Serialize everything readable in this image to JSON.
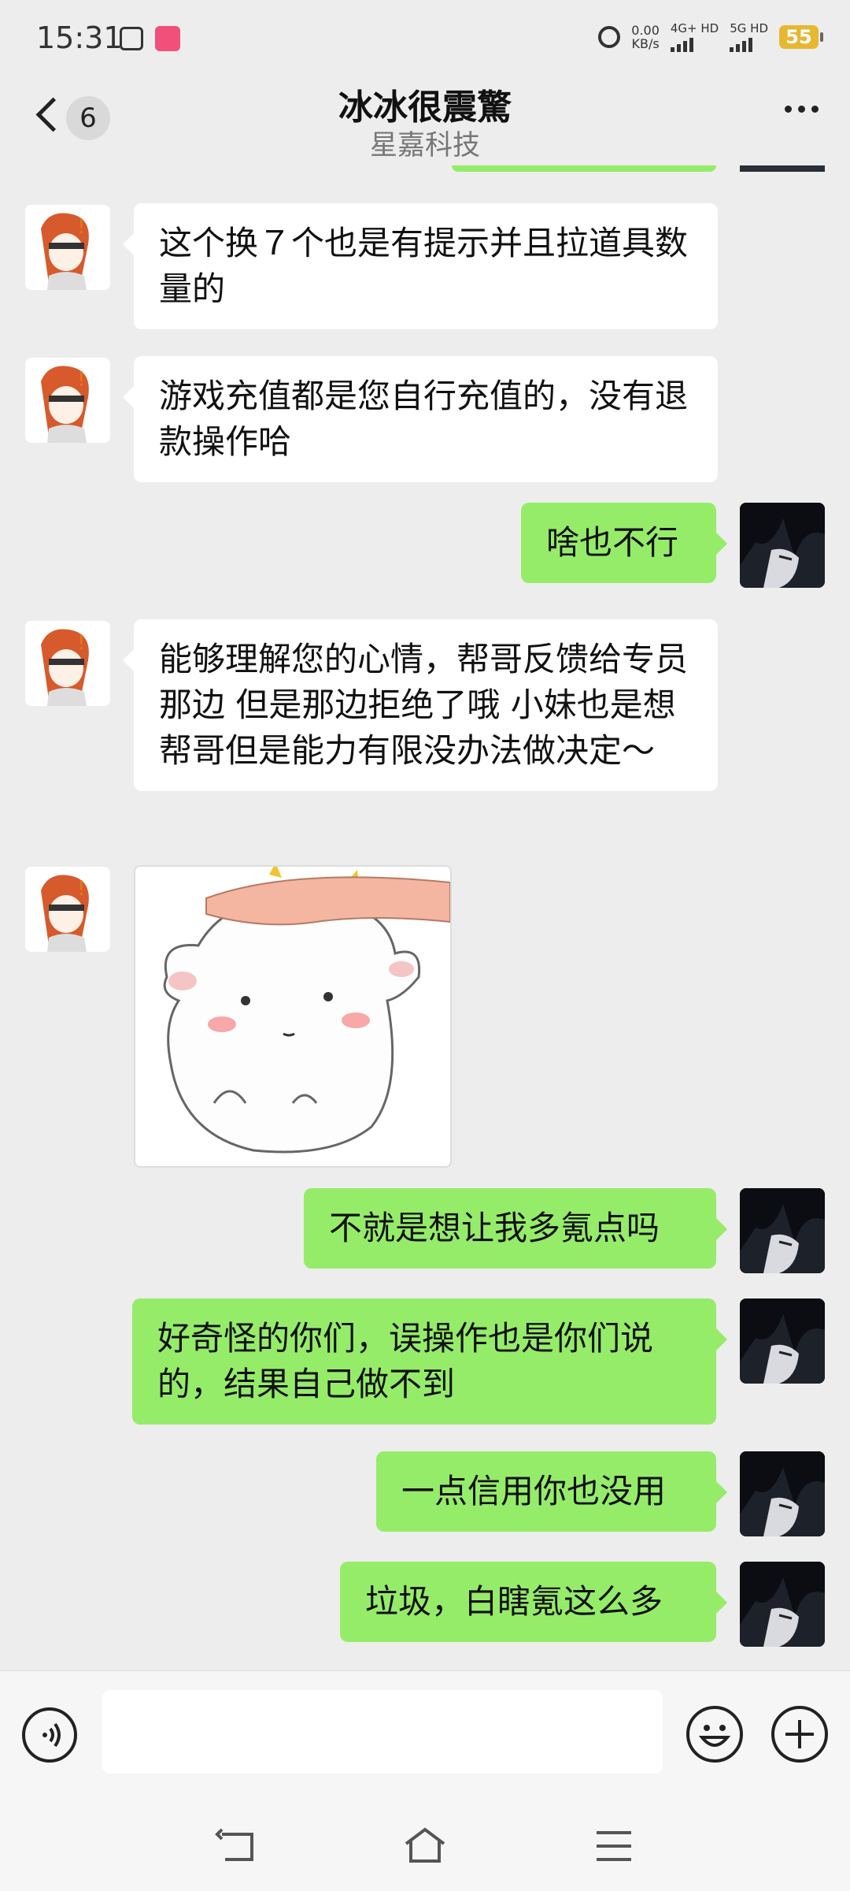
{
  "status_bar": {
    "time": "15:31",
    "net_speed": "0.00",
    "net_speed_unit": "KB/s",
    "sim1": "4G+ HD",
    "sim2": "5G HD",
    "battery": "55",
    "icons": [
      "app-notification-icon",
      "bilibili-icon",
      "alarm-icon",
      "signal-icon",
      "battery-icon"
    ]
  },
  "header": {
    "back_icon": "chevron-left-icon",
    "unread_count": "6",
    "title": "冰冰很震驚",
    "subtitle": "星嘉科技",
    "more_icon": "more-icon"
  },
  "messages": [
    {
      "side": "left",
      "type": "text",
      "text": "这个换７个也是有提示并且拉道具数量的"
    },
    {
      "side": "left",
      "type": "text",
      "text": "游戏充值都是您自行充值的，没有退款操作哈"
    },
    {
      "side": "right",
      "type": "text",
      "text": "啥也不行"
    },
    {
      "side": "left",
      "type": "text",
      "text": "能够理解您的心情，帮哥反馈给专员那边 但是那边拒绝了哦  小妹也是想帮哥但是能力有限没办法做决定～"
    },
    {
      "side": "left",
      "type": "sticker",
      "sticker": "cartoon-cow-head-pat"
    },
    {
      "side": "right",
      "type": "text",
      "text": "不就是想让我多氪点吗"
    },
    {
      "side": "right",
      "type": "text",
      "text": "好奇怪的你们，误操作也是你们说的，结果自己做不到"
    },
    {
      "side": "right",
      "type": "text",
      "text": "一点信用你也没用"
    },
    {
      "side": "right",
      "type": "text",
      "text": "垃圾，白瞎氪这么多"
    }
  ],
  "input_bar": {
    "voice_icon": "voice-icon",
    "input_value": "",
    "emoji_icon": "emoji-icon",
    "plus_icon": "plus-icon"
  },
  "nav_bar": {
    "icons": [
      "back-nav-icon",
      "home-icon",
      "menu-icon"
    ]
  },
  "colors": {
    "background": "#EDEDED",
    "outgoing_bubble": "#95EC69",
    "incoming_bubble": "#FFFFFF",
    "battery": "#E6B832"
  }
}
